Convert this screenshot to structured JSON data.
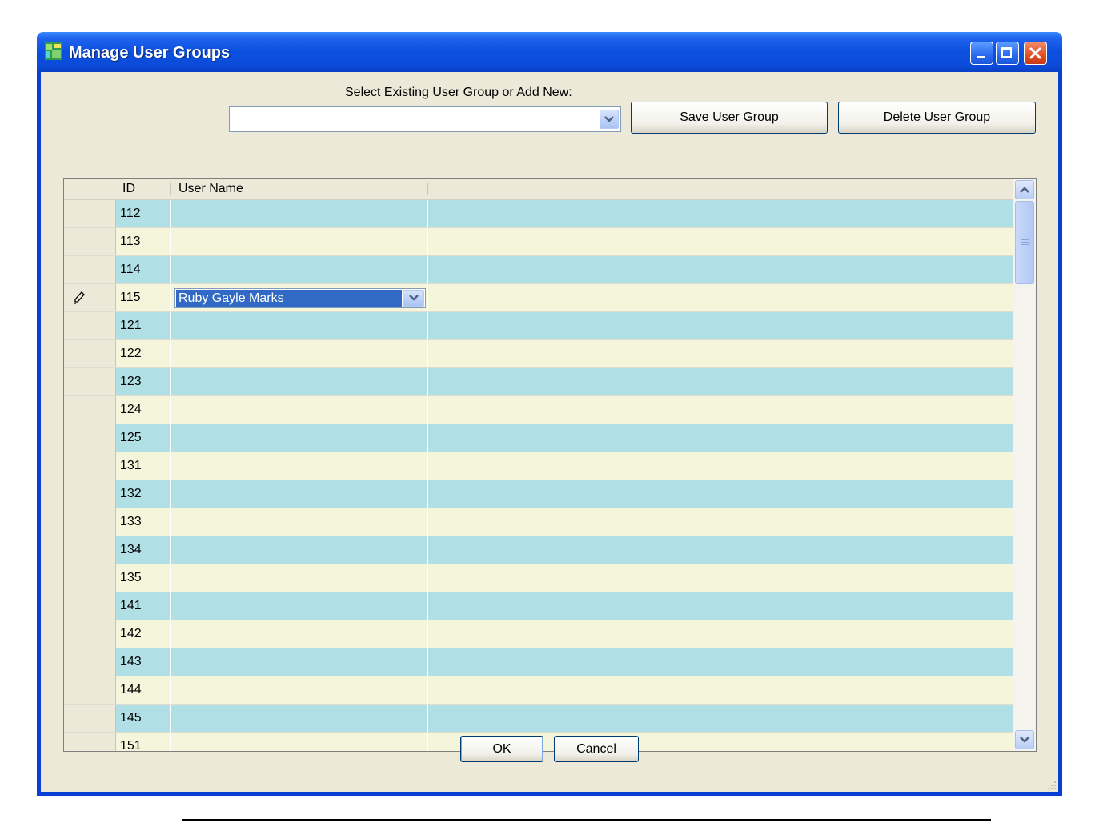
{
  "window": {
    "title": "Manage User Groups",
    "icon": "app-grid-icon",
    "controls": [
      "minimize-icon",
      "maximize-icon",
      "close-icon"
    ]
  },
  "group_select": {
    "label": "Select Existing User Group or Add New:",
    "value": ""
  },
  "buttons": {
    "save": "Save User Group",
    "delete": "Delete User Group",
    "ok": "OK",
    "cancel": "Cancel"
  },
  "grid": {
    "columns": [
      "ID",
      "User Name"
    ],
    "rows": [
      {
        "id": "112",
        "user_name": ""
      },
      {
        "id": "113",
        "user_name": ""
      },
      {
        "id": "114",
        "user_name": ""
      },
      {
        "id": "115",
        "user_name": "Ruby Gayle Marks",
        "editing": true
      },
      {
        "id": "121",
        "user_name": ""
      },
      {
        "id": "122",
        "user_name": ""
      },
      {
        "id": "123",
        "user_name": ""
      },
      {
        "id": "124",
        "user_name": ""
      },
      {
        "id": "125",
        "user_name": ""
      },
      {
        "id": "131",
        "user_name": ""
      },
      {
        "id": "132",
        "user_name": ""
      },
      {
        "id": "133",
        "user_name": ""
      },
      {
        "id": "134",
        "user_name": ""
      },
      {
        "id": "135",
        "user_name": ""
      },
      {
        "id": "141",
        "user_name": ""
      },
      {
        "id": "142",
        "user_name": ""
      },
      {
        "id": "143",
        "user_name": ""
      },
      {
        "id": "144",
        "user_name": ""
      },
      {
        "id": "145",
        "user_name": ""
      },
      {
        "id": "151",
        "user_name": ""
      }
    ],
    "row_colors": {
      "alt_a": "#b0e0e6",
      "alt_b": "#f5f5dc"
    },
    "edit_row_icon": "pencil-icon"
  },
  "colors": {
    "titlebar": "#0c4fe0",
    "dialog_bg": "#ece9d8",
    "selection": "#316ac5"
  }
}
